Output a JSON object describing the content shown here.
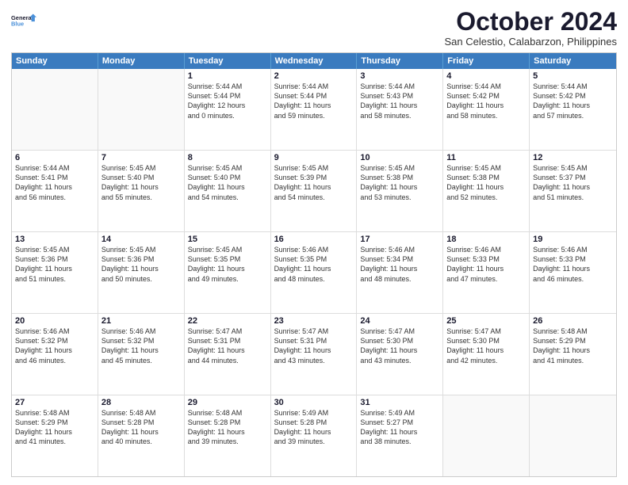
{
  "logo": {
    "general": "General",
    "blue": "Blue"
  },
  "title": "October 2024",
  "subtitle": "San Celestio, Calabarzon, Philippines",
  "headers": [
    "Sunday",
    "Monday",
    "Tuesday",
    "Wednesday",
    "Thursday",
    "Friday",
    "Saturday"
  ],
  "weeks": [
    [
      {
        "day": "",
        "text": ""
      },
      {
        "day": "",
        "text": ""
      },
      {
        "day": "1",
        "text": "Sunrise: 5:44 AM\nSunset: 5:44 PM\nDaylight: 12 hours\nand 0 minutes."
      },
      {
        "day": "2",
        "text": "Sunrise: 5:44 AM\nSunset: 5:44 PM\nDaylight: 11 hours\nand 59 minutes."
      },
      {
        "day": "3",
        "text": "Sunrise: 5:44 AM\nSunset: 5:43 PM\nDaylight: 11 hours\nand 58 minutes."
      },
      {
        "day": "4",
        "text": "Sunrise: 5:44 AM\nSunset: 5:42 PM\nDaylight: 11 hours\nand 58 minutes."
      },
      {
        "day": "5",
        "text": "Sunrise: 5:44 AM\nSunset: 5:42 PM\nDaylight: 11 hours\nand 57 minutes."
      }
    ],
    [
      {
        "day": "6",
        "text": "Sunrise: 5:44 AM\nSunset: 5:41 PM\nDaylight: 11 hours\nand 56 minutes."
      },
      {
        "day": "7",
        "text": "Sunrise: 5:45 AM\nSunset: 5:40 PM\nDaylight: 11 hours\nand 55 minutes."
      },
      {
        "day": "8",
        "text": "Sunrise: 5:45 AM\nSunset: 5:40 PM\nDaylight: 11 hours\nand 54 minutes."
      },
      {
        "day": "9",
        "text": "Sunrise: 5:45 AM\nSunset: 5:39 PM\nDaylight: 11 hours\nand 54 minutes."
      },
      {
        "day": "10",
        "text": "Sunrise: 5:45 AM\nSunset: 5:38 PM\nDaylight: 11 hours\nand 53 minutes."
      },
      {
        "day": "11",
        "text": "Sunrise: 5:45 AM\nSunset: 5:38 PM\nDaylight: 11 hours\nand 52 minutes."
      },
      {
        "day": "12",
        "text": "Sunrise: 5:45 AM\nSunset: 5:37 PM\nDaylight: 11 hours\nand 51 minutes."
      }
    ],
    [
      {
        "day": "13",
        "text": "Sunrise: 5:45 AM\nSunset: 5:36 PM\nDaylight: 11 hours\nand 51 minutes."
      },
      {
        "day": "14",
        "text": "Sunrise: 5:45 AM\nSunset: 5:36 PM\nDaylight: 11 hours\nand 50 minutes."
      },
      {
        "day": "15",
        "text": "Sunrise: 5:45 AM\nSunset: 5:35 PM\nDaylight: 11 hours\nand 49 minutes."
      },
      {
        "day": "16",
        "text": "Sunrise: 5:46 AM\nSunset: 5:35 PM\nDaylight: 11 hours\nand 48 minutes."
      },
      {
        "day": "17",
        "text": "Sunrise: 5:46 AM\nSunset: 5:34 PM\nDaylight: 11 hours\nand 48 minutes."
      },
      {
        "day": "18",
        "text": "Sunrise: 5:46 AM\nSunset: 5:33 PM\nDaylight: 11 hours\nand 47 minutes."
      },
      {
        "day": "19",
        "text": "Sunrise: 5:46 AM\nSunset: 5:33 PM\nDaylight: 11 hours\nand 46 minutes."
      }
    ],
    [
      {
        "day": "20",
        "text": "Sunrise: 5:46 AM\nSunset: 5:32 PM\nDaylight: 11 hours\nand 46 minutes."
      },
      {
        "day": "21",
        "text": "Sunrise: 5:46 AM\nSunset: 5:32 PM\nDaylight: 11 hours\nand 45 minutes."
      },
      {
        "day": "22",
        "text": "Sunrise: 5:47 AM\nSunset: 5:31 PM\nDaylight: 11 hours\nand 44 minutes."
      },
      {
        "day": "23",
        "text": "Sunrise: 5:47 AM\nSunset: 5:31 PM\nDaylight: 11 hours\nand 43 minutes."
      },
      {
        "day": "24",
        "text": "Sunrise: 5:47 AM\nSunset: 5:30 PM\nDaylight: 11 hours\nand 43 minutes."
      },
      {
        "day": "25",
        "text": "Sunrise: 5:47 AM\nSunset: 5:30 PM\nDaylight: 11 hours\nand 42 minutes."
      },
      {
        "day": "26",
        "text": "Sunrise: 5:48 AM\nSunset: 5:29 PM\nDaylight: 11 hours\nand 41 minutes."
      }
    ],
    [
      {
        "day": "27",
        "text": "Sunrise: 5:48 AM\nSunset: 5:29 PM\nDaylight: 11 hours\nand 41 minutes."
      },
      {
        "day": "28",
        "text": "Sunrise: 5:48 AM\nSunset: 5:28 PM\nDaylight: 11 hours\nand 40 minutes."
      },
      {
        "day": "29",
        "text": "Sunrise: 5:48 AM\nSunset: 5:28 PM\nDaylight: 11 hours\nand 39 minutes."
      },
      {
        "day": "30",
        "text": "Sunrise: 5:49 AM\nSunset: 5:28 PM\nDaylight: 11 hours\nand 39 minutes."
      },
      {
        "day": "31",
        "text": "Sunrise: 5:49 AM\nSunset: 5:27 PM\nDaylight: 11 hours\nand 38 minutes."
      },
      {
        "day": "",
        "text": ""
      },
      {
        "day": "",
        "text": ""
      }
    ]
  ]
}
